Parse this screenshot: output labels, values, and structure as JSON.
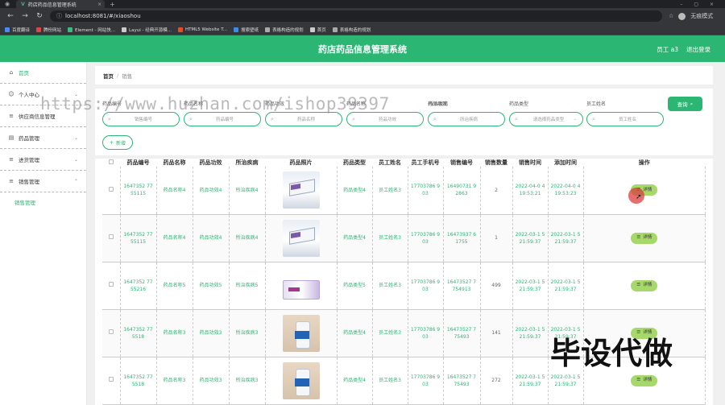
{
  "browser": {
    "tab_title": "药店药品信息管理系统",
    "url": "localhost:8081/#/xiaoshou",
    "profile_label": "无痕模式",
    "bookmarks": [
      "百度翻译",
      "腾份网站",
      "Element - 网站快...",
      "Layui - 经典开源模...",
      "HTML5 Website T...",
      "搜索壁纸",
      "表格构造的规划",
      "首页",
      "表格构造的规划"
    ]
  },
  "header": {
    "title": "药店药品信息管理系统",
    "user": "员工 a3",
    "logout": "退出登录"
  },
  "sidebar": {
    "items": [
      {
        "label": "首页",
        "icon": "home-icon"
      },
      {
        "label": "个人中心",
        "icon": "user-icon"
      },
      {
        "label": "供应商信息管理",
        "icon": "list-icon"
      },
      {
        "label": "药品管理",
        "icon": "medicine-icon"
      },
      {
        "label": "进货管理",
        "icon": "list-icon"
      },
      {
        "label": "销售管理",
        "icon": "list-icon"
      }
    ],
    "sub_item": "销售管理"
  },
  "breadcrumb": {
    "home": "首页",
    "sep": "/",
    "current": "销售"
  },
  "search": {
    "labels": [
      "药品编号",
      "药品名称",
      "药品功效",
      "药品名称",
      "药品功效",
      "所治疾病",
      "药品类型",
      "员工姓名"
    ],
    "placeholders": [
      "销售编号",
      "药品编号",
      "药品名称",
      "药品功效",
      "所治疾病",
      "请选择药品类型",
      "员工姓名"
    ],
    "query_label": "查询",
    "add_label": "新增"
  },
  "table": {
    "headers": [
      "药品编号",
      "药品名称",
      "药品功效",
      "所治疾病",
      "药品照片",
      "药品类型",
      "员工姓名",
      "员工手机号",
      "销售编号",
      "销售数量",
      "销售时间",
      "添加时间",
      "操作"
    ],
    "detail_label": "详情",
    "rows": [
      {
        "drug_no": "1647352 7755115",
        "name": "药品名称4",
        "effect": "药品功效4",
        "disease": "所治疾病4",
        "photo": "box",
        "type": "药品类型4",
        "staff": "员工姓名3",
        "phone": "17703786 903",
        "sale_no": "16490731 92863",
        "qty": "2",
        "sale_time": "2022-04-0 4 19:53:21",
        "add_time": "2022-04-0 4 19:53:23"
      },
      {
        "drug_no": "1647352 7755115",
        "name": "药品名称4",
        "effect": "药品功效4",
        "disease": "所治疾病4",
        "photo": "box",
        "type": "药品类型4",
        "staff": "员工姓名3",
        "phone": "17703786 903",
        "sale_no": "16473937 61755",
        "qty": "1",
        "sale_time": "2022-03-1 5 21:59:37",
        "add_time": "2022-03-1 5 21:59:37"
      },
      {
        "drug_no": "1647352 7755216",
        "name": "药品名称5",
        "effect": "药品功效5",
        "disease": "所治疾病5",
        "photo": "strip",
        "type": "药品类型5",
        "staff": "员工姓名3",
        "phone": "17703786 903",
        "sale_no": "16473527 7754913",
        "qty": "499",
        "sale_time": "2022-03-1 5 21:59:37",
        "add_time": "2022-03-1 5 21:59:37"
      },
      {
        "drug_no": "1647352 775518",
        "name": "药品名称3",
        "effect": "药品功效3",
        "disease": "所治疾病3",
        "photo": "bottle",
        "type": "药品类型4",
        "staff": "员工姓名3",
        "phone": "17703786 903",
        "sale_no": "16473527 775493",
        "qty": "141",
        "sale_time": "2022-03-1 5 21:59:37",
        "add_time": "2022-03-1 5 21:59:37"
      },
      {
        "drug_no": "1647352 775518",
        "name": "药品名称3",
        "effect": "药品功效3",
        "disease": "所治疾病3",
        "photo": "bottle",
        "type": "药品类型4",
        "staff": "员工姓名3",
        "phone": "17703786 903",
        "sale_no": "16473527 775493",
        "qty": "272",
        "sale_time": "2022-03-1 5 21:59:37",
        "add_time": "2022-03-1 5 21:59:37"
      }
    ]
  },
  "overlays": {
    "url_watermark": "https://www.huzhan.com/ishop39397",
    "big_watermark": "毕设代做"
  },
  "colors": {
    "primary": "#2bb673",
    "detail_button": "#a6d86a"
  }
}
